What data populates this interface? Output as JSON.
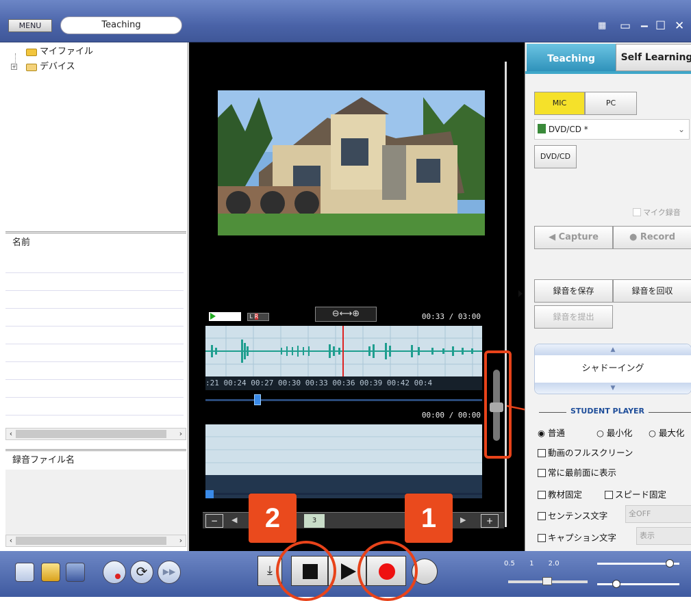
{
  "window": {
    "menu_label": "MENU",
    "title": "Teaching"
  },
  "tree": {
    "items": [
      {
        "label": "マイファイル"
      },
      {
        "label": "デバイス"
      }
    ]
  },
  "list1": {
    "header": "名前"
  },
  "list2": {
    "header": "録音ファイル名"
  },
  "player": {
    "time_top": "00:33 / 03:00",
    "time_bottom": "00:00 / 00:00",
    "timeline_labels": ":21  00:24  00:27  00:30  00:33  00:36  00:39  00:42  00:4",
    "page_number": "3",
    "position_fraction": 0.18
  },
  "right_panel": {
    "tabs": [
      {
        "label": "Teaching",
        "active": true
      },
      {
        "label": "Self Learning",
        "active": false
      }
    ],
    "source_buttons": [
      {
        "label": "MIC",
        "active": true
      },
      {
        "label": "PC",
        "active": false
      }
    ],
    "source_select": "DVD/CD *",
    "dvd_button": "DVD/CD",
    "mic_record_label": "マイク録音",
    "capture_label": "Capture",
    "record_label": "Record",
    "save_recording": "録音を保存",
    "collect_recording": "録音を回収",
    "submit_recording": "録音を提出",
    "mode_label": "シャドーイング",
    "student_player_label": "STUDENT PLAYER",
    "window_options": [
      {
        "label": "普通",
        "selected": true
      },
      {
        "label": "最小化",
        "selected": false
      },
      {
        "label": "最大化",
        "selected": false
      }
    ],
    "checkboxes": {
      "fullscreen": "動画のフルスクリーン",
      "topmost": "常に最前面に表示",
      "material_lock": "教材固定",
      "speed_lock": "スピード固定",
      "sentence_text": "センテンス文字",
      "sentence_value": "全OFF",
      "caption_text": "キャプション文字",
      "caption_value": "表示"
    }
  },
  "speed": {
    "ticks": [
      "0.5",
      "1",
      "2.0"
    ],
    "value": 1.0
  },
  "annotations": [
    {
      "number": "1",
      "target": "record-button"
    },
    {
      "number": "2",
      "target": "stop-button"
    }
  ],
  "colors": {
    "accent": "#e8431a",
    "title_bar": "#4a63a8",
    "tab_active": "#3fa7c9",
    "wave": "#1f9e8f"
  }
}
